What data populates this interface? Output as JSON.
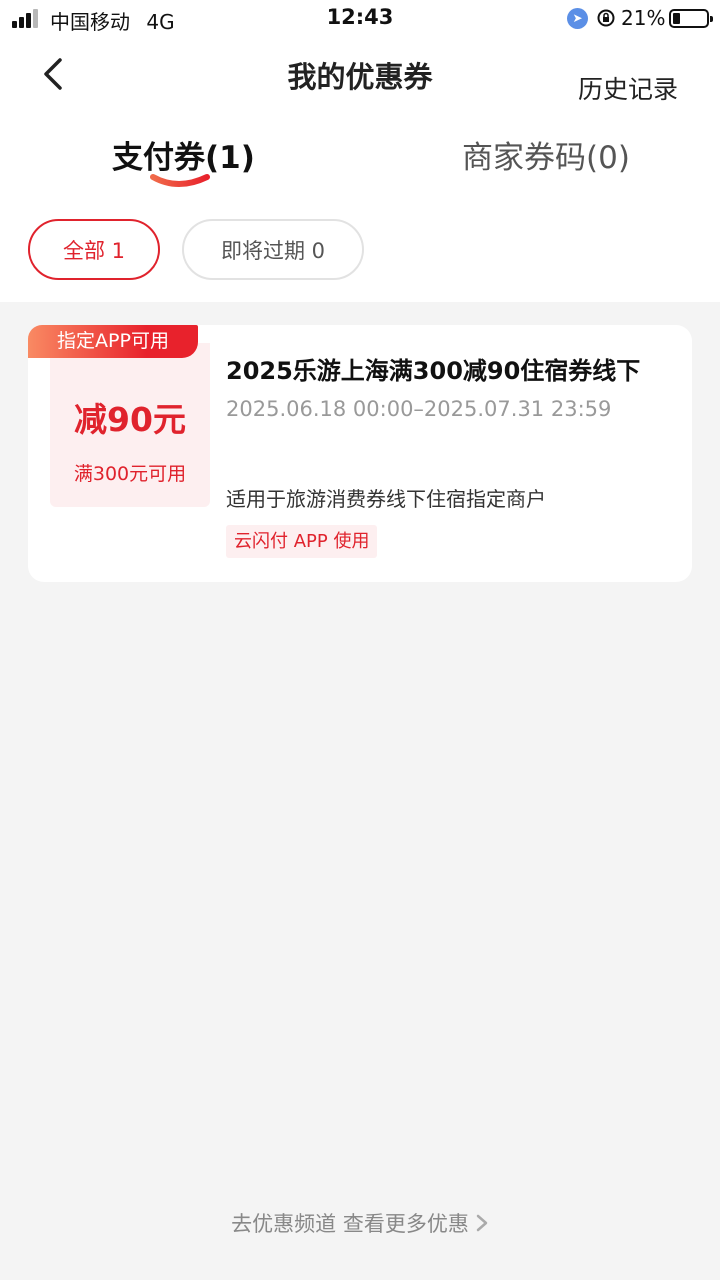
{
  "status_bar": {
    "carrier": "中国移动",
    "network": "4G",
    "time": "12:43",
    "battery": "21%"
  },
  "header": {
    "title": "我的优惠券",
    "history_label": "历史记录"
  },
  "tabs": [
    {
      "label": "支付券(1)",
      "active": true
    },
    {
      "label": "商家券码(0)",
      "active": false
    }
  ],
  "filters": [
    {
      "label": "全部 1",
      "active": true
    },
    {
      "label": "即将过期 0",
      "active": false
    }
  ],
  "coupon": {
    "tag": "指定APP可用",
    "amount": "减90元",
    "condition": "满300元可用",
    "title": "2025乐游上海满300减90住宿券线下",
    "validity": "2025.06.18 00:00–2025.07.31 23:59",
    "description": "适用于旅游消费券线下住宿指定商户",
    "badge": "云闪付 APP 使用"
  },
  "footer": {
    "more_link": "去优惠频道 查看更多优惠"
  },
  "colors": {
    "accent": "#e0232d",
    "accent_soft": "#fdeff0",
    "background": "#f4f4f4"
  }
}
